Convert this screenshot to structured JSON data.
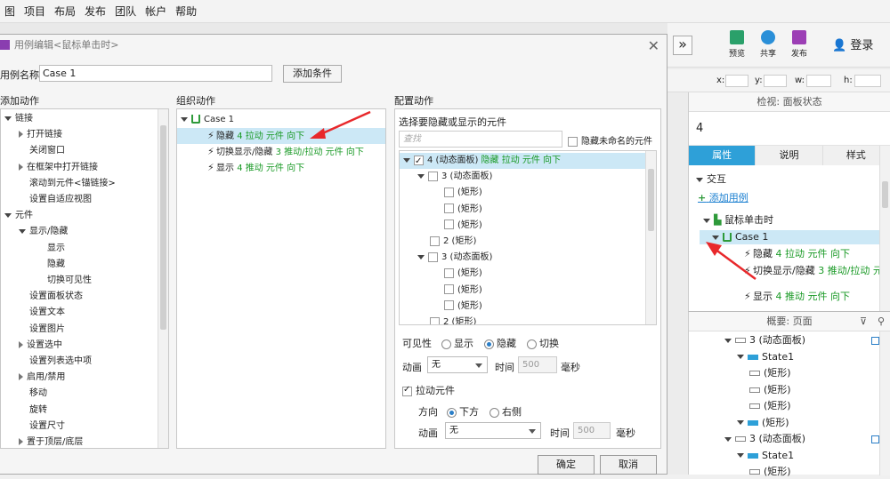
{
  "menu": [
    "图",
    "项目",
    "布局",
    "发布",
    "团队",
    "帐户",
    "帮助"
  ],
  "toolbar": {
    "collapse_glyph": "»",
    "preview": "预览",
    "share": "共享",
    "publish": "发布",
    "login": "登录"
  },
  "coords": {
    "x": "x:",
    "y": "y:",
    "w": "w:",
    "h": "h:"
  },
  "dialog": {
    "title": "用例编辑<鼠标单击时>",
    "case_label": "用例名称",
    "case_name": "Case 1",
    "add_condition": "添加条件",
    "col_add": "添加动作",
    "col_organize": "组织动作",
    "col_config": "配置动作",
    "ok": "确定",
    "cancel": "取消"
  },
  "add_actions": [
    {
      "text": "链接",
      "level": 0,
      "state": "open"
    },
    {
      "text": "打开链接",
      "level": 1,
      "state": "closed"
    },
    {
      "text": "关闭窗口",
      "level": 1,
      "state": "none"
    },
    {
      "text": "在框架中打开链接",
      "level": 1,
      "state": "closed"
    },
    {
      "text": "滚动到元件<锚链接>",
      "level": 1,
      "state": "none"
    },
    {
      "text": "设置自适应视图",
      "level": 1,
      "state": "none"
    },
    {
      "text": "元件",
      "level": 0,
      "state": "open"
    },
    {
      "text": "显示/隐藏",
      "level": 1,
      "state": "open"
    },
    {
      "text": "显示",
      "level": 2,
      "state": "none"
    },
    {
      "text": "隐藏",
      "level": 2,
      "state": "none"
    },
    {
      "text": "切换可见性",
      "level": 2,
      "state": "none"
    },
    {
      "text": "设置面板状态",
      "level": 1,
      "state": "none"
    },
    {
      "text": "设置文本",
      "level": 1,
      "state": "none"
    },
    {
      "text": "设置图片",
      "level": 1,
      "state": "none"
    },
    {
      "text": "设置选中",
      "level": 1,
      "state": "closed"
    },
    {
      "text": "设置列表选中项",
      "level": 1,
      "state": "none"
    },
    {
      "text": "启用/禁用",
      "level": 1,
      "state": "closed"
    },
    {
      "text": "移动",
      "level": 1,
      "state": "none"
    },
    {
      "text": "旋转",
      "level": 1,
      "state": "none"
    },
    {
      "text": "设置尺寸",
      "level": 1,
      "state": "none"
    },
    {
      "text": "置于顶层/底层",
      "level": 1,
      "state": "closed"
    }
  ],
  "organize": {
    "case": "Case 1",
    "actions": [
      {
        "verb": "隐藏 ",
        "rest": "4 拉动 元件 向下",
        "selected": true
      },
      {
        "verb": "切换显示/隐藏 ",
        "rest": "3 推动/拉动 元件 向下",
        "selected": false
      },
      {
        "verb": "显示 ",
        "rest": "4 推动 元件 向下",
        "selected": false
      }
    ]
  },
  "config": {
    "select_label": "选择要隐藏或显示的元件",
    "search_placeholder": "查找",
    "hide_unnamed": "隐藏未命名的元件",
    "tree": [
      {
        "text": "4 (动态面板)",
        "extra": " 隐藏 拉动 元件 向下",
        "level": 0,
        "arrow": true,
        "checked": true,
        "selected": true
      },
      {
        "text": "3 (动态面板)",
        "extra": "",
        "level": 1,
        "arrow": true,
        "checked": false,
        "selected": false
      },
      {
        "text": "(矩形)",
        "extra": "",
        "level": 2,
        "arrow": false,
        "checked": false,
        "selected": false
      },
      {
        "text": "(矩形)",
        "extra": "",
        "level": 2,
        "arrow": false,
        "checked": false,
        "selected": false
      },
      {
        "text": "(矩形)",
        "extra": "",
        "level": 2,
        "arrow": false,
        "checked": false,
        "selected": false
      },
      {
        "text": "2 (矩形)",
        "extra": "",
        "level": 1,
        "arrow": false,
        "checked": false,
        "selected": false
      },
      {
        "text": "3 (动态面板)",
        "extra": "",
        "level": 1,
        "arrow": true,
        "checked": false,
        "selected": false
      },
      {
        "text": "(矩形)",
        "extra": "",
        "level": 2,
        "arrow": false,
        "checked": false,
        "selected": false
      },
      {
        "text": "(矩形)",
        "extra": "",
        "level": 2,
        "arrow": false,
        "checked": false,
        "selected": false
      },
      {
        "text": "(矩形)",
        "extra": "",
        "level": 2,
        "arrow": false,
        "checked": false,
        "selected": false
      },
      {
        "text": "2 (矩形)",
        "extra": "",
        "level": 1,
        "arrow": false,
        "checked": false,
        "selected": false
      }
    ],
    "visibility_label": "可见性",
    "vis_show": "显示",
    "vis_hide": "隐藏",
    "vis_toggle": "切换",
    "anim_label": "动画",
    "anim_value": "无",
    "time_label": "时间",
    "time_value": "500",
    "ms": "毫秒",
    "pull_label": "拉动元件",
    "dir_label": "方向",
    "dir_down": "下方",
    "dir_right": "右侧",
    "anim2_label": "动画",
    "anim2_value": "无",
    "time2_label": "时间",
    "time2_value": "500",
    "ms2": "毫秒"
  },
  "inspector": {
    "title": "检视: 面板状态",
    "name": "4",
    "tabs": [
      "属性",
      "说明",
      "样式"
    ],
    "interaction": "交互",
    "add_case": "添加用例",
    "event": "鼠标单击时",
    "case": "Case 1",
    "actions": [
      {
        "verb": "隐藏 ",
        "rest": "4 拉动 元件 向下"
      },
      {
        "verb": "切换显示/隐藏 ",
        "rest": "3 推动/拉动 元件 向下"
      },
      {
        "verb": "显示 ",
        "rest": "4 推动 元件 向下"
      }
    ]
  },
  "outline": {
    "title": "概要: 页面",
    "items": [
      {
        "text": "3 (动态面板)",
        "level": 0
      },
      {
        "text": "State1",
        "level": 1
      },
      {
        "text": "(矩形)",
        "level": 2
      },
      {
        "text": "(矩形)",
        "level": 2
      },
      {
        "text": "(矩形)",
        "level": 2
      },
      {
        "text": "(矩形)",
        "level": 1
      },
      {
        "text": "3 (动态面板)",
        "level": 0
      },
      {
        "text": "State1",
        "level": 1
      },
      {
        "text": "(矩形)",
        "level": 2
      }
    ]
  },
  "colors": {
    "accent": "#2ea0d8",
    "green": "#1a9a26",
    "selected_row": "#cce8f6",
    "arrow": "#e8282b"
  }
}
